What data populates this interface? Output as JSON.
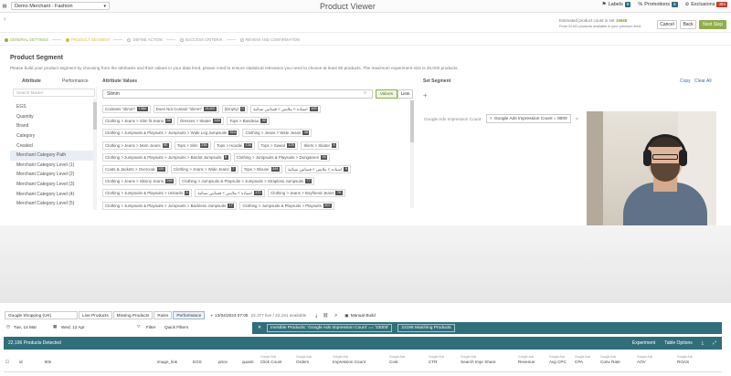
{
  "topbar": {
    "account": "Demo Merchant - Fashion",
    "app_title": "Product Viewer",
    "labels_label": "Labels",
    "labels_count": "9",
    "promotions_label": "Promotions",
    "promotions_count": "6",
    "exclusions_label": "Exclusions",
    "exclusions_count": "394"
  },
  "header": {
    "back": "‹",
    "estimate_text": "Estimated product count in set",
    "estimate_value": "19668",
    "estimate_sub": "From 22181 products available in your premium feed.",
    "cancel": "Cancel",
    "back_btn": "Back",
    "next": "Next Step"
  },
  "steps": [
    {
      "label": "GENERAL SETTINGS",
      "state": "done"
    },
    {
      "label": "PRODUCT SEGMENT",
      "state": "active"
    },
    {
      "label": "DEFINE ACTION",
      "state": "todo"
    },
    {
      "label": "SUCCESS CRITERIA",
      "state": "todo"
    },
    {
      "label": "REVIEW AND CONFIRMATION",
      "state": "todo"
    }
  ],
  "segment": {
    "title": "Product Segment",
    "description": "Please build your product segment by choosing from the attributes and their values in your data feed, please mind to ensure statistical relevance you need to choose at least 50 products. The maximum experiment size is 20,000 products."
  },
  "columns": {
    "attribute": "Attribute",
    "performance": "Performance",
    "attribute_values": "Attribute Values",
    "set_segment": "Set Segment",
    "copy": "Copy",
    "clear_all": "Clear All"
  },
  "left": {
    "search_placeholder": "Search Master",
    "attributes": [
      "EGS",
      "Quantity",
      "Brand",
      "Category",
      "Created",
      "Merchant Category Path",
      "Merchant Category Level (1)",
      "Merchant Category Level (2)",
      "Merchant Category Level (3)",
      "Merchant Category Level (4)",
      "Merchant Category Level (5)"
    ]
  },
  "values": {
    "search_value": "Slimm",
    "toggle_values": "Values",
    "toggle_lists": "Lists",
    "rows": [
      [
        {
          "t": "Contains \"slimm\"",
          "c": "1384"
        },
        {
          "t": "Does Not Contain \"slimm\"",
          "c": "21422"
        },
        {
          "t": "(Empty)",
          "c": "0"
        },
        {
          "t": "اسپادە > ملابس > فساتين نسائية",
          "c": "109"
        }
      ],
      [
        {
          "t": "Clothing > Jeans > Slim fit Jeans",
          "c": "65"
        },
        {
          "t": "Dresses > Skater",
          "c": "160"
        },
        {
          "t": "Tops > Bandeau",
          "c": "32"
        }
      ],
      [
        {
          "t": "Clothing > Jumpsuits & Playsuits > Jumpsuits > Wide Leg Jumpsuits",
          "c": "514"
        },
        {
          "t": "Clothing > Jeans > Wide Jeans",
          "c": "48"
        }
      ],
      [
        {
          "t": "Clothing > Jeans > Mom Jeans",
          "c": "50"
        },
        {
          "t": "Tops > Slim",
          "c": "236"
        },
        {
          "t": "Tops > Hoodie",
          "c": "134"
        },
        {
          "t": "Tops > Sweat",
          "c": "125"
        },
        {
          "t": "Skirts > Skater",
          "c": "6"
        }
      ],
      [
        {
          "t": "Clothing > Jumpsuits & Playsuits > Jumpsuits > Bardot Jumpsuits",
          "c": "5"
        },
        {
          "t": "Clothing > Jumpsuits & Playsuits > Dungarees",
          "c": "34"
        }
      ],
      [
        {
          "t": "Coats & Jackets > Overcoat",
          "c": "130"
        },
        {
          "t": "Clothing > Jeans > Wide Jeans",
          "c": "7"
        },
        {
          "t": "Tops > Blouse",
          "c": "344"
        },
        {
          "t": "اسپادە > ملابس > فساتين نسائية",
          "c": "9"
        }
      ],
      [
        {
          "t": "Clothing > Jeans > Skinny Jeans",
          "c": "244"
        },
        {
          "t": "Clothing > Jumpsuits & Playsuits > Jumpsuits > Strapless Jumpsuits",
          "c": "77"
        }
      ],
      [
        {
          "t": "Clothing > Jumpsuits & Playsuits > Unitards",
          "c": "6"
        },
        {
          "t": "اسپادە > ملابس > فساتين نسائية",
          "c": "170"
        },
        {
          "t": "Clothing > Jeans > Boyfriend Jeans",
          "c": "76"
        }
      ],
      [
        {
          "t": "Clothing > Jumpsuits & Playsuits > Jumpsuits > Backless Jumpsuits",
          "c": "17"
        },
        {
          "t": "Clothing > Jumpsuits & Playsuits > Playsuits",
          "c": "307"
        }
      ]
    ]
  },
  "segment_panel": {
    "plus": "+",
    "condition_label": "Google Ads Impression Count",
    "condition_value": "Google Ads Impression Count = 0000",
    "remove": "×",
    "link": "Add condition"
  },
  "bottom": {
    "tabs": [
      "Google Shopping (UK)",
      "Line Products",
      "Missing Products",
      "Rules",
      "Performance"
    ],
    "sync": "13/04/2023 07:05",
    "sync_counts": "22,377 live / 22,181 available",
    "manual": "Manual Build",
    "date_from": "Tue, 14 Mar",
    "date_to": "Wed, 12 Apr",
    "filter": "Filter",
    "quick_filters": "Quick Filters",
    "invisible": "Invisible Products: 'Google Ads Impression Count' == '33000'",
    "matching": "22196 Matching Products",
    "detected": "22,196 Products Detected",
    "experiment": "Experiment",
    "table_options": "Table Options",
    "columns": [
      {
        "h": "id",
        "sub": ""
      },
      {
        "h": "title",
        "sub": ""
      },
      {
        "h": "image_link",
        "sub": ""
      },
      {
        "h": "EGS",
        "sub": ""
      },
      {
        "h": "price",
        "sub": ""
      },
      {
        "h": "quanti",
        "sub": ""
      },
      {
        "h": "Click Count",
        "sub": "Google Ads"
      },
      {
        "h": "Orders",
        "sub": "Google Ads"
      },
      {
        "h": "Impression Count",
        "sub": "Google Ads"
      },
      {
        "h": "Cost",
        "sub": "Google Ads"
      },
      {
        "h": "CTR",
        "sub": "Google Ads"
      },
      {
        "h": "Search Impr Share",
        "sub": "Google Ads"
      },
      {
        "h": "Revenue",
        "sub": "Google Ads"
      },
      {
        "h": "Avg CPC",
        "sub": "Google Ads"
      },
      {
        "h": "CPA",
        "sub": "Google Ads"
      },
      {
        "h": "Conv Rate",
        "sub": "Google Ads"
      },
      {
        "h": "AOV",
        "sub": "Google Ads"
      },
      {
        "h": "ROAS",
        "sub": "Google Ads"
      }
    ]
  },
  "colors": {
    "accent": "#8fae4a",
    "teal": "#2f6f7a",
    "active_step": "#e1b83a",
    "link": "#4a6ea0"
  }
}
